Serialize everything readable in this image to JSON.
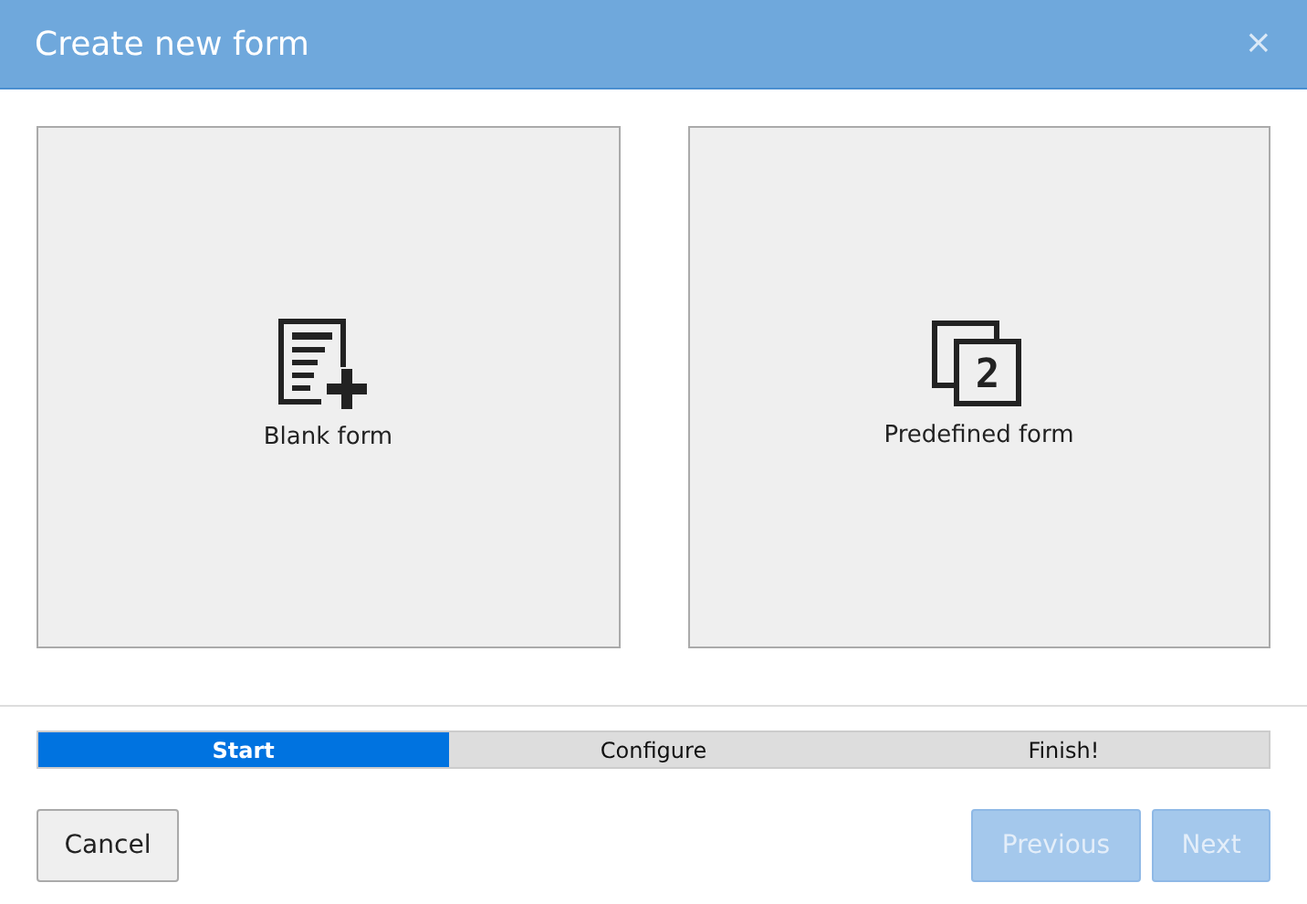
{
  "dialog": {
    "title": "Create new form",
    "close": "×"
  },
  "options": [
    {
      "kind": "blank",
      "label": "Blank form"
    },
    {
      "kind": "predefined",
      "label": "Predefined form",
      "icon_text": "2"
    }
  ],
  "steps": [
    {
      "label": "Start",
      "selected": true
    },
    {
      "label": "Configure",
      "selected": false
    },
    {
      "label": "Finish!",
      "selected": false
    }
  ],
  "buttons": [
    {
      "label": "Cancel",
      "kind": "secondary",
      "disabled": false
    },
    {
      "label": "Previous",
      "kind": "primary",
      "disabled": true
    },
    {
      "label": "Next",
      "kind": "primary",
      "disabled": true
    }
  ]
}
